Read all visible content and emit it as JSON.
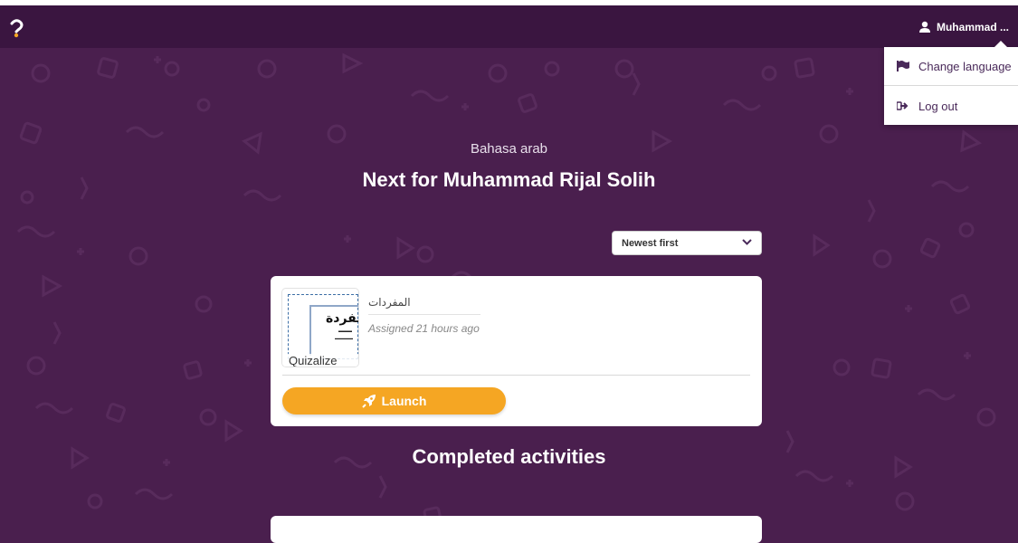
{
  "header": {
    "top_strip_text": "",
    "user_name": "Muhammad ..."
  },
  "user_menu": {
    "items": [
      {
        "label": "Change language",
        "icon": "flag-icon"
      },
      {
        "label": "Log out",
        "icon": "sign-out-icon"
      }
    ]
  },
  "main": {
    "class_name": "Bahasa arab",
    "title": "Next for Muhammad Rijal Solih",
    "sort": {
      "selected": "Newest first"
    },
    "assignments": [
      {
        "thumbnail_arabic": "مفردة)",
        "thumbnail_source": "Quizalize",
        "title": "المفردات",
        "assigned": "Assigned 21 hours ago",
        "launch_label": "Launch"
      }
    ],
    "completed_heading": "Completed activities"
  },
  "colors": {
    "background": "#4a1f4e",
    "navbar": "#3a1540",
    "launch": "#f5a623",
    "menu_text": "#4a2a5a"
  }
}
